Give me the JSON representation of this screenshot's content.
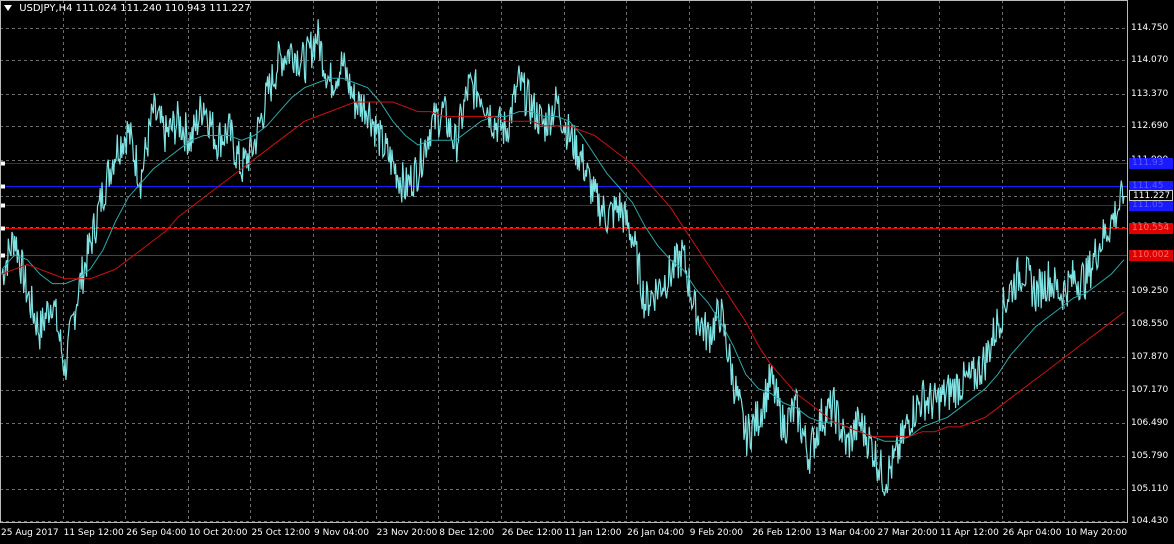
{
  "header": {
    "symbol": "USDJPY,H4",
    "ohlc": "111.024 111.240 110.943 111.227"
  },
  "colors": {
    "background": "#000000",
    "grid": "#6e6e6e",
    "candles": "#7fe3e3",
    "ma_fast": "#2aa8a8",
    "ma_slow": "#d01010",
    "level_blue": "#1a1aff",
    "level_red": "#e00000"
  },
  "chart_data": {
    "type": "line",
    "title": "USDJPY,H4",
    "y_ticks": [
      "114.750",
      "114.070",
      "113.370",
      "112.690",
      "111.990",
      "111.227",
      "110.590",
      "109.250",
      "108.550",
      "107.870",
      "107.170",
      "106.490",
      "105.790",
      "105.110",
      "104.430"
    ],
    "x_ticks": [
      "25 Aug 2017",
      "11 Sep 12:00",
      "26 Sep 04:00",
      "10 Oct 20:00",
      "25 Oct 12:00",
      "9 Nov 04:00",
      "23 Nov 20:00",
      "8 Dec 12:00",
      "26 Dec 12:00",
      "11 Jan 12:00",
      "26 Jan 04:00",
      "9 Feb 20:00",
      "26 Feb 12:00",
      "13 Mar 04:00",
      "27 Mar 20:00",
      "11 Apr 12:00",
      "26 Apr 04:00",
      "10 May 20:00"
    ],
    "ylim": [
      104.43,
      114.75
    ],
    "grid": true,
    "current_price": "111.227",
    "levels": [
      {
        "value": 111.93,
        "label": "111.93",
        "color": "blue"
      },
      {
        "value": 111.45,
        "label": "111.45",
        "color": "blue"
      },
      {
        "value": 111.05,
        "label": "111.05",
        "color": "blue"
      },
      {
        "value": 110.554,
        "label": "110.554",
        "color": "red"
      },
      {
        "value": 110.002,
        "label": "110.002",
        "color": "red"
      }
    ],
    "series": [
      {
        "values": [
          109.6,
          110.4,
          109.2,
          108.4,
          109.1,
          107.6,
          109.2,
          110.2,
          111.3,
          112.2,
          112.6,
          111.6,
          113.0,
          112.5,
          112.8,
          112.4,
          113.2,
          112.4,
          112.6,
          111.8,
          112.3,
          113.3,
          114.1,
          114.3,
          114.0,
          114.6,
          113.6,
          114.0,
          113.2,
          113.1,
          112.4,
          111.9,
          111.4,
          111.8,
          112.7,
          113.0,
          112.3,
          113.5,
          113.4,
          112.8,
          112.6,
          113.6,
          113.1,
          112.7,
          113.2,
          112.5,
          112.0,
          111.2,
          110.8,
          111.0,
          110.4,
          109.0,
          109.3,
          109.6,
          110.0,
          108.8,
          108.3,
          108.8,
          107.4,
          106.2,
          106.6,
          107.4,
          106.4,
          106.8,
          105.8,
          106.6,
          106.8,
          106.0,
          106.5,
          106.0,
          105.3,
          105.8,
          106.6,
          107.0,
          106.9,
          107.1,
          107.3,
          107.4,
          107.8,
          108.6,
          109.3,
          109.7,
          109.2,
          109.5,
          109.2,
          109.5,
          109.5,
          110.2,
          110.7,
          111.23
        ],
        "color_key": "candles"
      },
      {
        "values": [
          109.7,
          110.0,
          109.9,
          109.6,
          109.4,
          109.4,
          109.5,
          109.7,
          110.1,
          110.7,
          111.2,
          111.5,
          111.8,
          112.0,
          112.2,
          112.4,
          112.5,
          112.5,
          112.5,
          112.4,
          112.5,
          112.7,
          113.0,
          113.3,
          113.5,
          113.6,
          113.7,
          113.7,
          113.6,
          113.5,
          113.2,
          112.8,
          112.5,
          112.3,
          112.4,
          112.4,
          112.4,
          112.6,
          112.8,
          112.9,
          112.9,
          113.0,
          113.0,
          112.9,
          112.9,
          112.8,
          112.5,
          112.1,
          111.7,
          111.4,
          111.1,
          110.6,
          110.2,
          109.9,
          109.7,
          109.3,
          109.0,
          108.6,
          108.1,
          107.5,
          107.2,
          107.1,
          106.9,
          106.8,
          106.6,
          106.5,
          106.5,
          106.4,
          106.3,
          106.2,
          106.1,
          106.1,
          106.2,
          106.4,
          106.5,
          106.6,
          106.8,
          107.0,
          107.2,
          107.5,
          107.9,
          108.2,
          108.5,
          108.7,
          108.9,
          109.1,
          109.2,
          109.4,
          109.6,
          109.9
        ],
        "color_key": "ma_fast"
      },
      {
        "values": [
          109.6,
          109.7,
          109.8,
          109.7,
          109.6,
          109.5,
          109.5,
          109.5,
          109.6,
          109.7,
          109.9,
          110.1,
          110.3,
          110.5,
          110.8,
          111.0,
          111.2,
          111.4,
          111.6,
          111.8,
          112.0,
          112.2,
          112.4,
          112.6,
          112.8,
          112.9,
          113.0,
          113.1,
          113.2,
          113.2,
          113.2,
          113.2,
          113.1,
          113.0,
          113.0,
          112.9,
          112.9,
          112.9,
          112.9,
          112.9,
          112.8,
          112.8,
          112.8,
          112.7,
          112.7,
          112.7,
          112.6,
          112.5,
          112.3,
          112.1,
          111.9,
          111.6,
          111.3,
          111.0,
          110.6,
          110.2,
          109.8,
          109.4,
          109.0,
          108.6,
          108.1,
          107.7,
          107.4,
          107.1,
          106.9,
          106.7,
          106.5,
          106.4,
          106.3,
          106.2,
          106.2,
          106.2,
          106.2,
          106.3,
          106.3,
          106.4,
          106.4,
          106.5,
          106.6,
          106.8,
          107.0,
          107.2,
          107.4,
          107.6,
          107.8,
          108.0,
          108.2,
          108.4,
          108.6,
          108.8
        ],
        "color_key": "ma_slow"
      }
    ]
  }
}
